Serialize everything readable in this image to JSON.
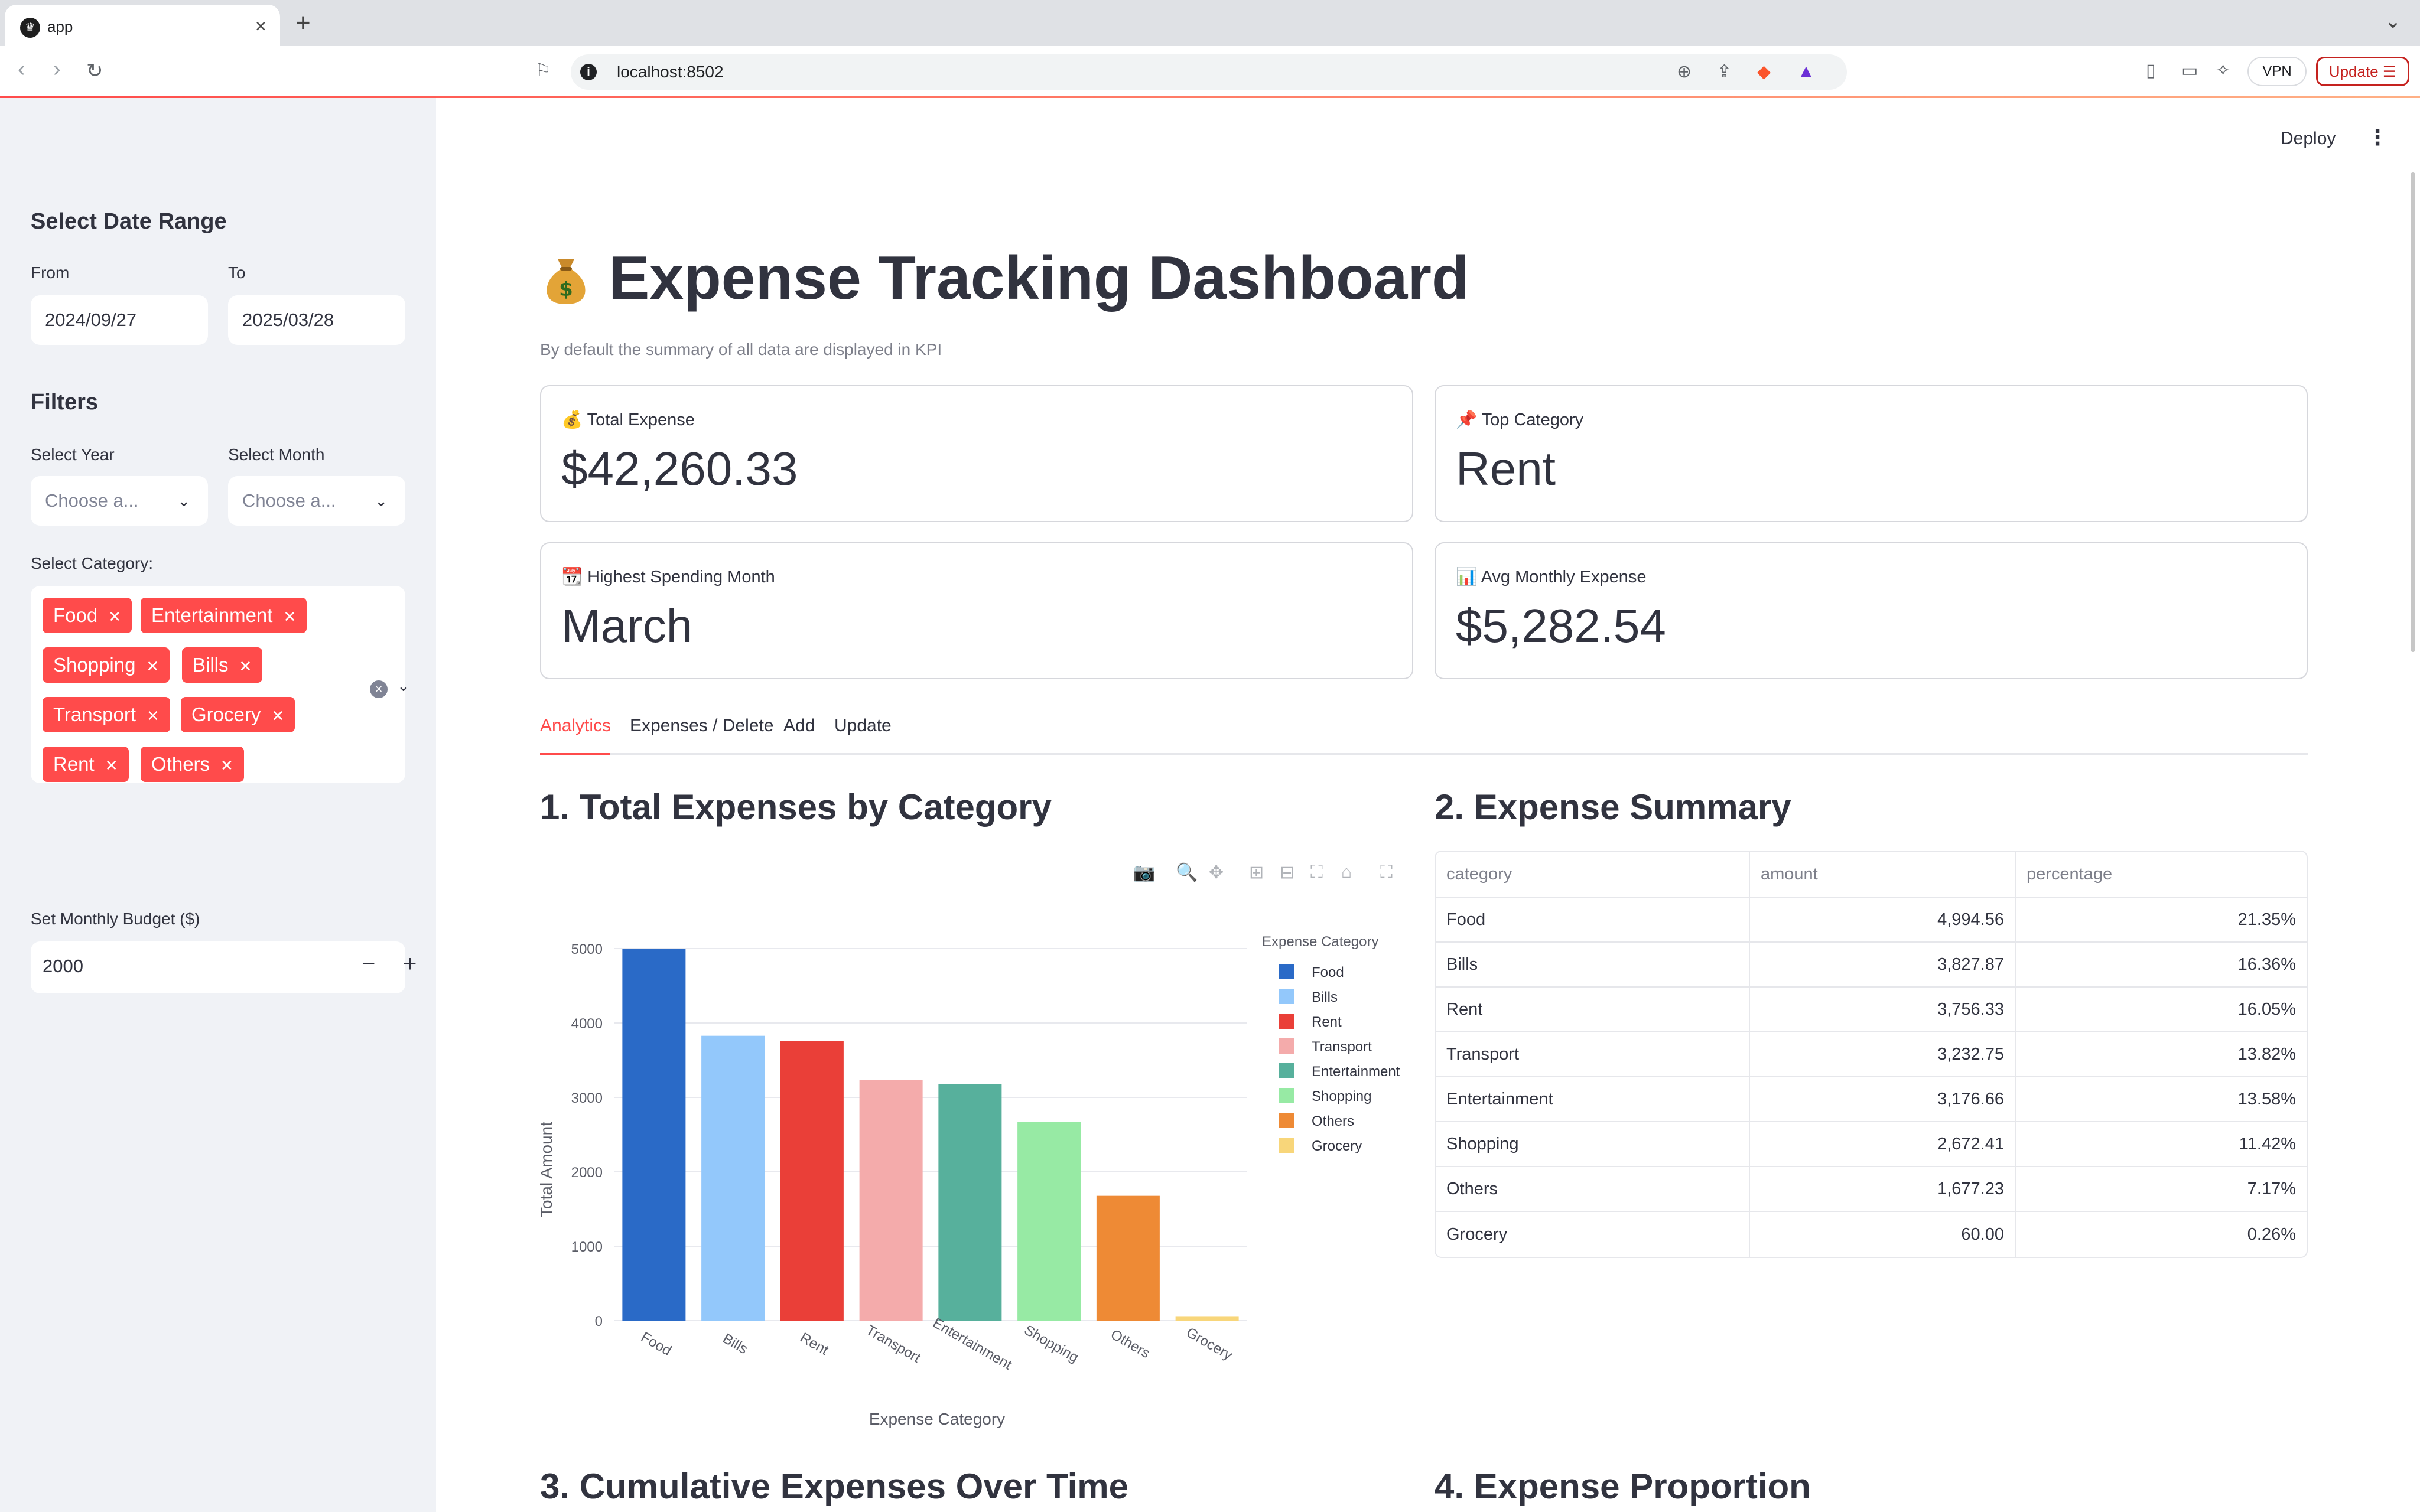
{
  "browser": {
    "tab_title": "app",
    "url": "localhost:8502",
    "vpn_label": "VPN",
    "update_label": "Update"
  },
  "sidebar": {
    "date_heading": "Select Date Range",
    "from_label": "From",
    "from_value": "2024/09/27",
    "to_label": "To",
    "to_value": "2025/03/28",
    "filters_heading": "Filters",
    "year_label": "Select Year",
    "year_placeholder": "Choose a...",
    "month_label": "Select Month",
    "month_placeholder": "Choose a...",
    "category_label": "Select Category:",
    "categories": [
      "Food",
      "Entertainment",
      "Shopping",
      "Bills",
      "Transport",
      "Grocery",
      "Rent",
      "Others"
    ],
    "budget_label": "Set Monthly Budget ($)",
    "budget_value": "2000"
  },
  "header": {
    "deploy_label": "Deploy"
  },
  "main": {
    "title": "Expense Tracking Dashboard",
    "subtitle": "By default the summary of all data are displayed in KPI",
    "kpis": [
      {
        "icon": "💰",
        "label": "Total Expense",
        "value": "$42,260.33"
      },
      {
        "icon": "📌",
        "label": "Top Category",
        "value": "Rent"
      },
      {
        "icon": "📆",
        "label": "Highest Spending Month",
        "value": "March"
      },
      {
        "icon": "📊",
        "label": "Avg Monthly Expense",
        "value": "$5,282.54"
      }
    ],
    "tabs": [
      "Analytics",
      "Expenses / Delete",
      "Add",
      "Update"
    ],
    "section1": "1. Total Expenses by Category",
    "section2": "2. Expense Summary",
    "section3": "3. Cumulative Expenses Over Time",
    "section4": "4. Expense Proportion"
  },
  "summary_table": {
    "columns": [
      "category",
      "amount",
      "percentage"
    ],
    "rows": [
      [
        "Food",
        "4,994.56",
        "21.35%"
      ],
      [
        "Bills",
        "3,827.87",
        "16.36%"
      ],
      [
        "Rent",
        "3,756.33",
        "16.05%"
      ],
      [
        "Transport",
        "3,232.75",
        "13.82%"
      ],
      [
        "Entertainment",
        "3,176.66",
        "13.58%"
      ],
      [
        "Shopping",
        "2,672.41",
        "11.42%"
      ],
      [
        "Others",
        "1,677.23",
        "7.17%"
      ],
      [
        "Grocery",
        "60.00",
        "0.26%"
      ]
    ]
  },
  "chart_data": {
    "type": "bar",
    "title": "",
    "xlabel": "Expense Category",
    "ylabel": "Total Amount",
    "legend_title": "Expense Category",
    "legend_position": "right",
    "ylim": [
      0,
      5000
    ],
    "yticks": [
      0,
      1000,
      2000,
      3000,
      4000,
      5000
    ],
    "grid": true,
    "categories": [
      "Food",
      "Bills",
      "Rent",
      "Transport",
      "Entertainment",
      "Shopping",
      "Others",
      "Grocery"
    ],
    "values": [
      4994.56,
      3827.87,
      3756.33,
      3232.75,
      3176.66,
      2672.41,
      1677.23,
      60.0
    ],
    "colors": [
      "#2a6ac7",
      "#93c8fb",
      "#ea3f38",
      "#f4abab",
      "#57b09c",
      "#97eaa4",
      "#ee8a35",
      "#f8d67a"
    ]
  }
}
